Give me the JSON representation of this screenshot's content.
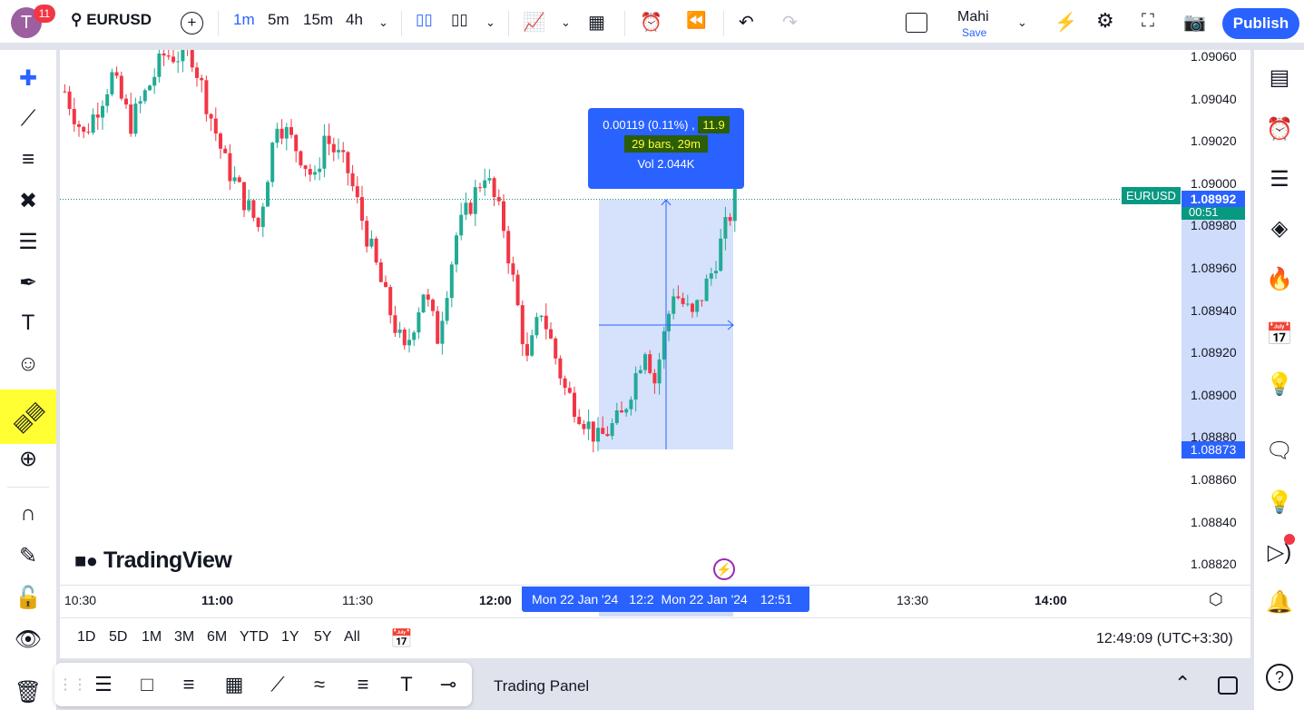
{
  "header": {
    "avatar_letter": "T",
    "notification_count": "11",
    "symbol": "EURUSD",
    "intervals": [
      "1m",
      "5m",
      "15m",
      "4h"
    ],
    "active_interval": "1m",
    "layout_name": "Mahi",
    "save_label": "Save",
    "publish_label": "Publish"
  },
  "chart": {
    "symbol_tag": "EURUSD",
    "last_price": "1.08992",
    "countdown": "00:51",
    "measure_low_label": "1.08873",
    "price_ticks": [
      "1.09060",
      "1.09040",
      "1.09020",
      "1.09000",
      "1.08980",
      "1.08960",
      "1.08940",
      "1.08920",
      "1.08900",
      "1.08880",
      "1.08860",
      "1.08840",
      "1.08820"
    ],
    "time_ticks": [
      "10:30",
      "11:00",
      "11:30",
      "12:00",
      "13:30",
      "14:00"
    ],
    "time_cursor_start": "Mon 22 Jan '24",
    "time_cursor_start_time": "12:2",
    "time_cursor_end": "Mon 22 Jan '24",
    "time_cursor_end_time": "12:51",
    "measure": {
      "change": "0.00119 (0.11%) ,",
      "pips": "11.9",
      "bars": "29 bars, 29m",
      "volume": "Vol 2.044K"
    },
    "logo": "TradingView",
    "colors": {
      "up": "#22ab94",
      "down": "#f23645",
      "accent": "#2962ff",
      "measure_fill": "#cfdcfb"
    },
    "price_path": [
      [
        "10:27",
        1.09043
      ],
      [
        "10:31",
        1.09022
      ],
      [
        "10:37",
        1.0905
      ],
      [
        "10:41",
        1.09028
      ],
      [
        "10:48",
        1.0906
      ],
      [
        "10:54",
        1.0906
      ],
      [
        "11:01",
        1.09009
      ],
      [
        "11:08",
        1.08979
      ],
      [
        "11:12",
        1.0903
      ],
      [
        "11:17",
        1.09013
      ],
      [
        "11:20",
        1.09
      ],
      [
        "11:22",
        1.09022
      ],
      [
        "11:27",
        1.09005
      ],
      [
        "11:35",
        1.08945
      ],
      [
        "11:39",
        1.08919
      ],
      [
        "11:43",
        1.08949
      ],
      [
        "11:46",
        1.08927
      ],
      [
        "11:50",
        1.08975
      ],
      [
        "11:56",
        1.09005
      ],
      [
        "12:00",
        1.08979
      ],
      [
        "12:05",
        1.08915
      ],
      [
        "12:08",
        1.0894
      ],
      [
        "12:13",
        1.08902
      ],
      [
        "12:20",
        1.08878
      ],
      [
        "12:25",
        1.08889
      ],
      [
        "12:30",
        1.08923
      ],
      [
        "12:32",
        1.08906
      ],
      [
        "12:36",
        1.08949
      ],
      [
        "12:40",
        1.08936
      ],
      [
        "12:44",
        1.08957
      ],
      [
        "12:49",
        1.08992
      ]
    ]
  },
  "range_bar": {
    "ranges": [
      "1D",
      "5D",
      "1M",
      "3M",
      "6M",
      "YTD",
      "1Y",
      "5Y",
      "All"
    ],
    "clock": "12:49:09 (UTC+3:30)"
  },
  "bottom_panel": {
    "title": "Trading Panel"
  }
}
